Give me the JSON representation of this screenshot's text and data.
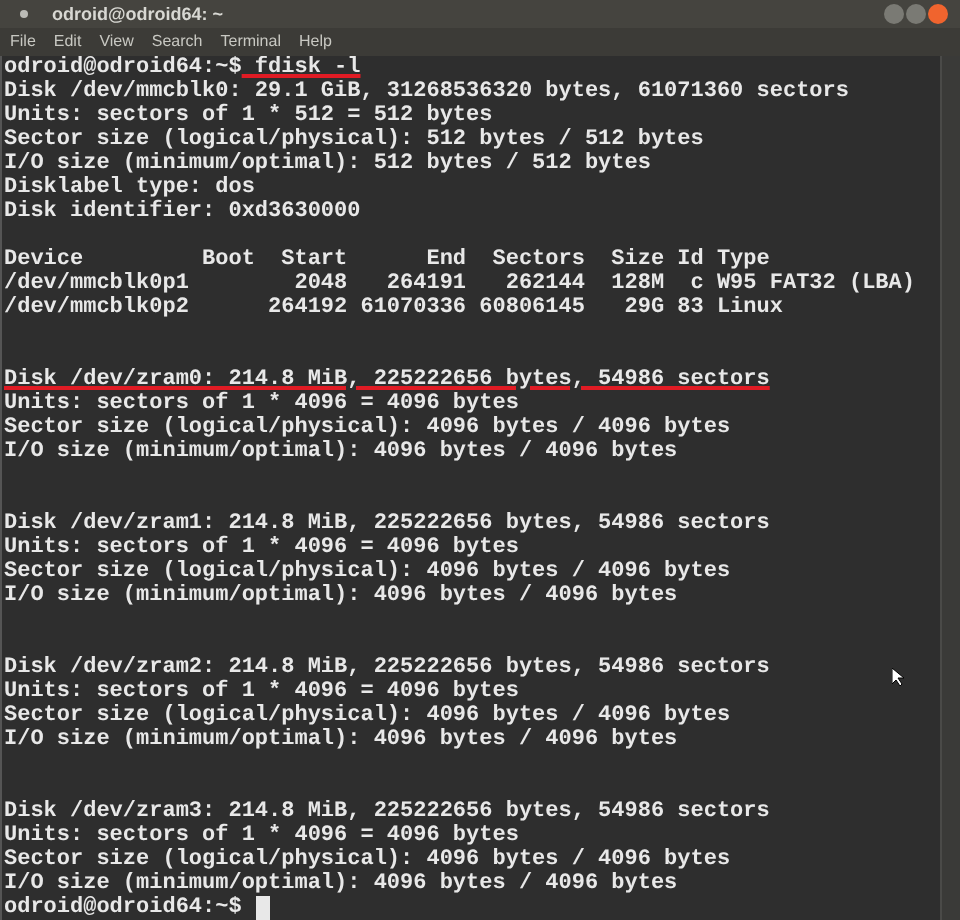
{
  "window": {
    "title": "odroid@odroid64: ~"
  },
  "menu": [
    "File",
    "Edit",
    "View",
    "Search",
    "Terminal",
    "Help"
  ],
  "lines": [
    {
      "kind": "prompt",
      "prompt": "odroid@odroid64:~$",
      "command": "fdisk -l",
      "highlighted": true
    },
    {
      "kind": "output",
      "text": "Disk /dev/mmcblk0: 29.1 GiB, 31268536320 bytes, 61071360 sectors",
      "highlighted": false
    },
    {
      "kind": "output",
      "text": "Units: sectors of 1 * 512 = 512 bytes",
      "highlighted": false
    },
    {
      "kind": "output",
      "text": "Sector size (logical/physical): 512 bytes / 512 bytes",
      "highlighted": false
    },
    {
      "kind": "output",
      "text": "I/O size (minimum/optimal): 512 bytes / 512 bytes",
      "highlighted": false
    },
    {
      "kind": "output",
      "text": "Disklabel type: dos",
      "highlighted": false
    },
    {
      "kind": "output",
      "text": "Disk identifier: 0xd3630000",
      "highlighted": false
    },
    {
      "kind": "blank"
    },
    {
      "kind": "output",
      "text": "Device         Boot  Start      End  Sectors  Size Id Type",
      "highlighted": false
    },
    {
      "kind": "output",
      "text": "/dev/mmcblk0p1        2048   264191   262144  128M  c W95 FAT32 (LBA)",
      "highlighted": false
    },
    {
      "kind": "output",
      "text": "/dev/mmcblk0p2      264192 61070336 60806145   29G 83 Linux",
      "highlighted": false
    },
    {
      "kind": "blank"
    },
    {
      "kind": "blank"
    },
    {
      "kind": "output",
      "text": "Disk /dev/zram0: 214.8 MiB, 225222656 bytes, 54986 sectors",
      "highlighted": true
    },
    {
      "kind": "output",
      "text": "Units: sectors of 1 * 4096 = 4096 bytes",
      "highlighted": false
    },
    {
      "kind": "output",
      "text": "Sector size (logical/physical): 4096 bytes / 4096 bytes",
      "highlighted": false
    },
    {
      "kind": "output",
      "text": "I/O size (minimum/optimal): 4096 bytes / 4096 bytes",
      "highlighted": false
    },
    {
      "kind": "blank"
    },
    {
      "kind": "blank"
    },
    {
      "kind": "output",
      "text": "Disk /dev/zram1: 214.8 MiB, 225222656 bytes, 54986 sectors",
      "highlighted": false
    },
    {
      "kind": "output",
      "text": "Units: sectors of 1 * 4096 = 4096 bytes",
      "highlighted": false
    },
    {
      "kind": "output",
      "text": "Sector size (logical/physical): 4096 bytes / 4096 bytes",
      "highlighted": false
    },
    {
      "kind": "output",
      "text": "I/O size (minimum/optimal): 4096 bytes / 4096 bytes",
      "highlighted": false
    },
    {
      "kind": "blank"
    },
    {
      "kind": "blank"
    },
    {
      "kind": "output",
      "text": "Disk /dev/zram2: 214.8 MiB, 225222656 bytes, 54986 sectors",
      "highlighted": false
    },
    {
      "kind": "output",
      "text": "Units: sectors of 1 * 4096 = 4096 bytes",
      "highlighted": false
    },
    {
      "kind": "output",
      "text": "Sector size (logical/physical): 4096 bytes / 4096 bytes",
      "highlighted": false
    },
    {
      "kind": "output",
      "text": "I/O size (minimum/optimal): 4096 bytes / 4096 bytes",
      "highlighted": false
    },
    {
      "kind": "blank"
    },
    {
      "kind": "blank"
    },
    {
      "kind": "output",
      "text": "Disk /dev/zram3: 214.8 MiB, 225222656 bytes, 54986 sectors",
      "highlighted": false
    },
    {
      "kind": "output",
      "text": "Units: sectors of 1 * 4096 = 4096 bytes",
      "highlighted": false
    },
    {
      "kind": "output",
      "text": "Sector size (logical/physical): 4096 bytes / 4096 bytes",
      "highlighted": false
    },
    {
      "kind": "output",
      "text": "I/O size (minimum/optimal): 4096 bytes / 4096 bytes",
      "highlighted": false
    },
    {
      "kind": "prompt",
      "prompt": "odroid@odroid64:~$",
      "cursor": true
    }
  ]
}
